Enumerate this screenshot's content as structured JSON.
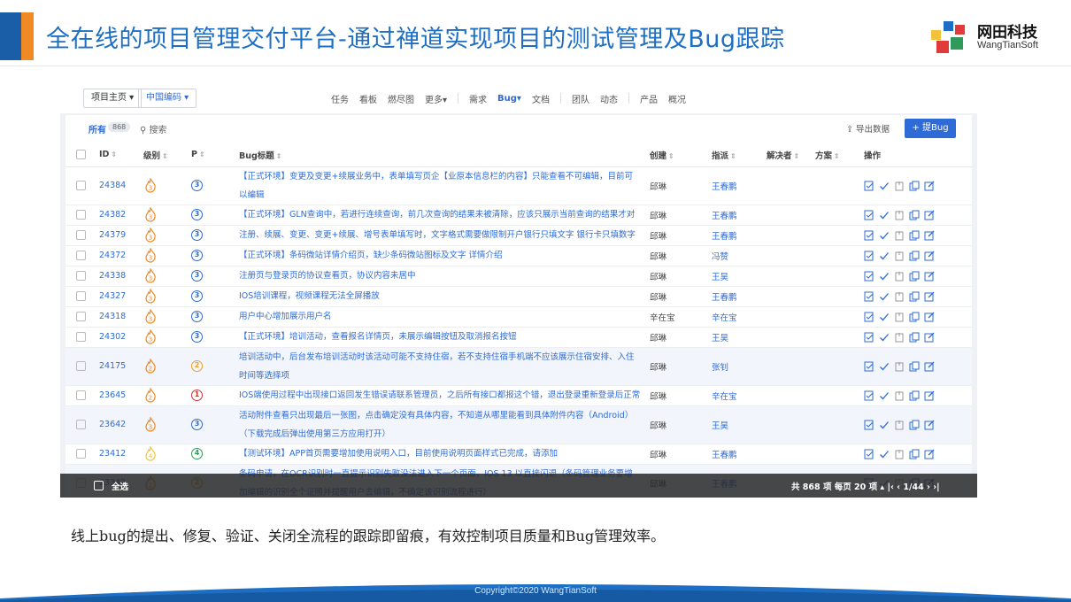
{
  "slide": {
    "title": "全在线的项目管理交付平台-通过禅道实现项目的测试管理及Bug跟踪",
    "caption": "线上bug的提出、修复、验证、关闭全流程的跟踪即留痕，有效控制项目质量和Bug管理效率。",
    "copyright": "Copyright©2020 WangTianSoft",
    "accent_color": "#1e6fc4"
  },
  "logo": {
    "name": "网田科技",
    "sub": "WangTianSoft"
  },
  "app": {
    "breadcrumb": [
      "项目主页 ▾",
      "中国编码 ▾"
    ],
    "nav": [
      "任务",
      "看板",
      "燃尽图",
      "更多▾",
      "需求",
      "Bug▾",
      "文档",
      "团队",
      "动态",
      "产品",
      "概况"
    ],
    "tab_all": "所有",
    "tab_count": "868",
    "search": "搜索",
    "export": "导出数据",
    "add_bug": "+ 提Bug",
    "columns": [
      "ID",
      "级别",
      "P",
      "Bug标题",
      "创建",
      "指派",
      "解决者",
      "方案",
      "操作"
    ],
    "rows": [
      {
        "id": "24384",
        "sev": "3",
        "pri": "3",
        "title": "【正式环境】变更及变更+续展业务中，表单填写页企【业原本信息栏的内容】只能查看不可编辑，目前可以编辑",
        "creator": "邱琳",
        "assigned": "王春鹏"
      },
      {
        "id": "24382",
        "sev": "3",
        "pri": "3",
        "title": "【正式环境】GLN查询中，若进行连续查询，前几次查询的结果未被清除，应该只展示当前查询的结果才对",
        "creator": "邱琳",
        "assigned": "王春鹏"
      },
      {
        "id": "24379",
        "sev": "3",
        "pri": "3",
        "title": "注册、续展、变更、变更+续展、增号表单填写时，文字格式需要做限制开户银行只填文字 银行卡只填数字",
        "creator": "邱琳",
        "assigned": "王春鹏"
      },
      {
        "id": "24372",
        "sev": "3",
        "pri": "3",
        "title": "【正式环境】条码微站详情介绍页，缺少条码微站图标及文字 详情介绍",
        "creator": "邱琳",
        "assigned": "冯赞"
      },
      {
        "id": "24338",
        "sev": "3",
        "pri": "3",
        "title": "注册页与登录页的协议查看页，协议内容未居中",
        "creator": "邱琳",
        "assigned": "王昊"
      },
      {
        "id": "24327",
        "sev": "3",
        "pri": "3",
        "title": "IOS培训课程，视频课程无法全屏播放",
        "creator": "邱琳",
        "assigned": "王春鹏"
      },
      {
        "id": "24318",
        "sev": "3",
        "pri": "3",
        "title": "用户中心增加展示用户名",
        "creator": "辛在宝",
        "assigned": "辛在宝"
      },
      {
        "id": "24302",
        "sev": "3",
        "pri": "3",
        "title": "【正式环境】培训活动，查看报名详情页，未展示编辑按钮及取消报名按钮",
        "creator": "邱琳",
        "assigned": "王昊"
      },
      {
        "id": "24175",
        "sev": "2",
        "pri": "2",
        "title": "培训活动中，后台发布培训活动时该活动可能不支持住宿，若不支持住宿手机端不应该展示住宿安排、入住时间等选择项",
        "creator": "邱琳",
        "assigned": "张钊",
        "tall": true
      },
      {
        "id": "23645",
        "sev": "2",
        "pri": "1",
        "title": "IOS端使用过程中出现接口返回发生错误请联系管理员，之后所有接口都报这个错，退出登录重新登录后正常",
        "creator": "邱琳",
        "assigned": "辛在宝"
      },
      {
        "id": "23642",
        "sev": "3",
        "pri": "3",
        "title": "活动附件查看只出现最后一张图，点击确定没有具体内容，不知道从哪里能看到具体附件内容（Android）（下载完成后弹出使用第三方应用打开）",
        "creator": "邱琳",
        "assigned": "王昊",
        "tall": true
      },
      {
        "id": "23412",
        "sev": "4",
        "pri": "4",
        "title": "【测试环境】APP首页需要增加使用说明入口，目前使用说明页面样式已完成，请添加",
        "creator": "邱琳",
        "assigned": "王春鹏"
      },
      {
        "id": "23342",
        "sev": "2",
        "pri": "2",
        "title": "条码申请，在OCR识别时一直提示识别失败没法进入下一个页面，IOS 13 以直接闪退（条码管理业务要增加编辑的识别全个证照并提醒用户去编辑，不确定该识别流程进行）",
        "creator": "邱琳",
        "assigned": "王春鹏",
        "tall": true
      }
    ],
    "footer": {
      "select_all": "全选",
      "pager": "共 868 项  每页 20 项 ▴   |‹  ‹  1/44  ›  ›|"
    }
  },
  "colors": {
    "sev_orange": "#f08a24",
    "pri_blue": "#2e6bd6",
    "pri_orange": "#f0a020",
    "pri_red": "#d23030",
    "pri_green": "#2f9a5a",
    "sev_yellow": "#f3c23c"
  }
}
